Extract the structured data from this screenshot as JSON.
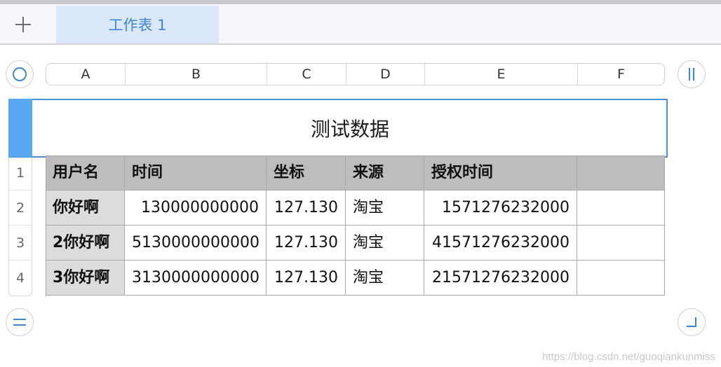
{
  "tabbar": {
    "add_icon": "plus-icon",
    "sheet_tab_label": "工作表 1"
  },
  "controls": {
    "top_left_icon": "circle-icon",
    "top_right_icon": "pause-bars-icon",
    "bottom_left_icon": "equals-icon",
    "bottom_right_icon": "corner-resize-icon"
  },
  "columns": [
    "A",
    "B",
    "C",
    "D",
    "E",
    "F"
  ],
  "rows": [
    "1",
    "2",
    "3",
    "4"
  ],
  "table": {
    "title": "测试数据",
    "headers": [
      "用户名",
      "时间",
      "坐标",
      "来源",
      "授权时间",
      ""
    ],
    "data": [
      [
        "你好啊",
        "130000000000",
        "127.130",
        "淘宝",
        "1571276232000",
        ""
      ],
      [
        "2你好啊",
        "5130000000000",
        "127.130",
        "淘宝",
        "41571276232000",
        ""
      ],
      [
        "3你好啊",
        "3130000000000",
        "127.130",
        "淘宝",
        "21571276232000",
        ""
      ]
    ]
  },
  "watermark": "https://blog.csdn.net/guoqiankunmiss",
  "colors": {
    "accent": "#4a90d9",
    "tab_active_bg": "#dbe8fa",
    "header_row_bg": "#bdbdbd",
    "row_label_bg": "#dcdcdc"
  }
}
